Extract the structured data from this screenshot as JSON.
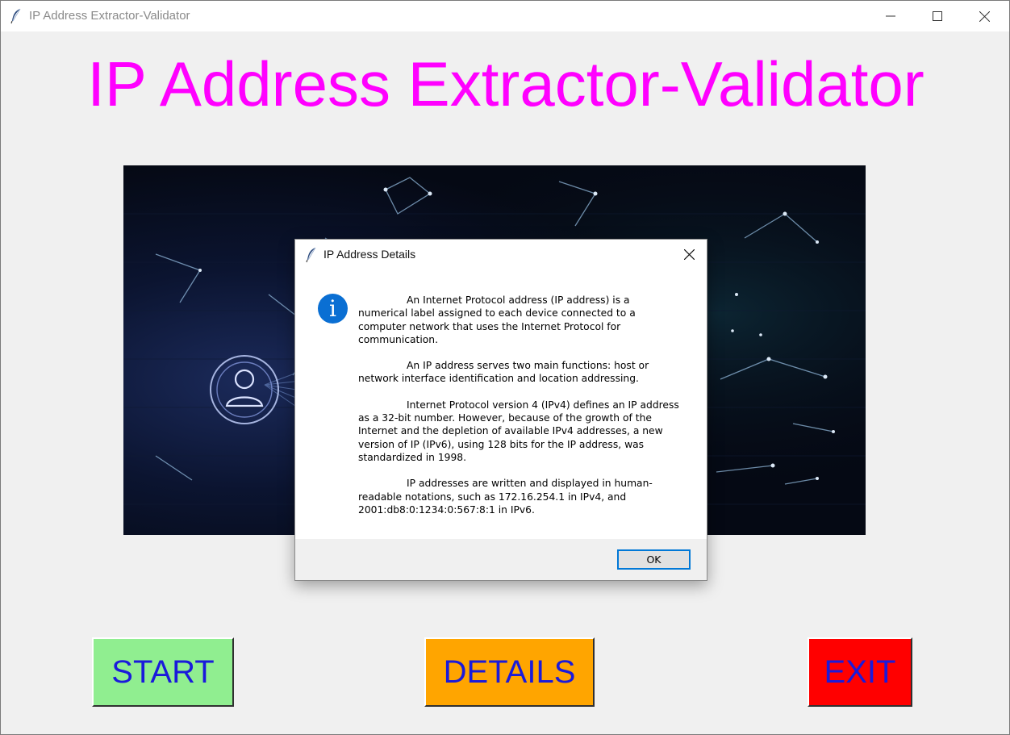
{
  "window": {
    "title": "IP Address Extractor-Validator",
    "controls": {
      "minimize": "minimize-icon",
      "maximize": "maximize-icon",
      "close": "close-icon"
    },
    "app_icon": "tk-feather-icon"
  },
  "heading": {
    "text": "IP Address Extractor-Validator",
    "color": "#ff00ff"
  },
  "banner": {
    "image": "network-connections-image",
    "icon": "user-profile-icon"
  },
  "buttons": {
    "start": {
      "label": "START",
      "color": "#90ee90"
    },
    "details": {
      "label": "DETAILS",
      "color": "#ffa500"
    },
    "exit": {
      "label": "EXIT",
      "color": "#ff0000"
    },
    "text_color": "#1a1adb"
  },
  "dialog": {
    "title": "IP Address Details",
    "icon": "info-icon",
    "icon_glyph": "i",
    "paragraphs": [
      "An Internet Protocol address (IP address) is a numerical label assigned to each device connected to a computer network that uses the Internet Protocol for communication.",
      "An IP address serves two main functions: host or network interface identification and location addressing.",
      "Internet Protocol version 4 (IPv4) defines an IP address as a 32-bit number. However, because of the growth of the Internet and the depletion of available IPv4 addresses, a new version of IP (IPv6), using 128 bits for the IP address, was standardized in 1998.",
      "IP addresses are written and displayed in human-readable notations, such as 172.16.254.1 in IPv4, and 2001:db8:0:1234:0:567:8:1 in IPv6."
    ],
    "ok_label": "OK"
  }
}
